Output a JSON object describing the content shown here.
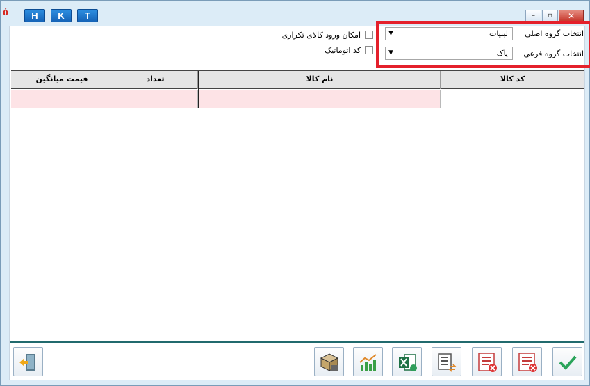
{
  "titlebar": {
    "buttons": [
      "H",
      "K",
      "T"
    ],
    "controls": {
      "minimize": "–",
      "restore": "▫",
      "close": "✕"
    }
  },
  "filters": {
    "main_group": {
      "label": "انتخاب گروه اصلی",
      "value": "لبنیات"
    },
    "sub_group": {
      "label": "انتخاب گروه فرعی",
      "value": "پاک"
    },
    "allow_duplicate": {
      "label": "امکان ورود کالای تکراری",
      "checked": false
    },
    "auto_code": {
      "label": "کد اتوماتیک",
      "checked": false
    }
  },
  "grid": {
    "columns": [
      "قیمت میانگین",
      "تعداد",
      "نام کالا",
      "کد کالا"
    ]
  },
  "toolbar": {
    "icons": [
      "exit-icon",
      "package-icon",
      "chart-icon",
      "excel-export-icon",
      "list-transfer-icon",
      "delete-list-icon",
      "delete-list-icon",
      "confirm-check-icon"
    ]
  },
  "colors": {
    "highlight": "#e4202b",
    "accent": "#216a6d",
    "row_pink": "#fde3e6"
  }
}
